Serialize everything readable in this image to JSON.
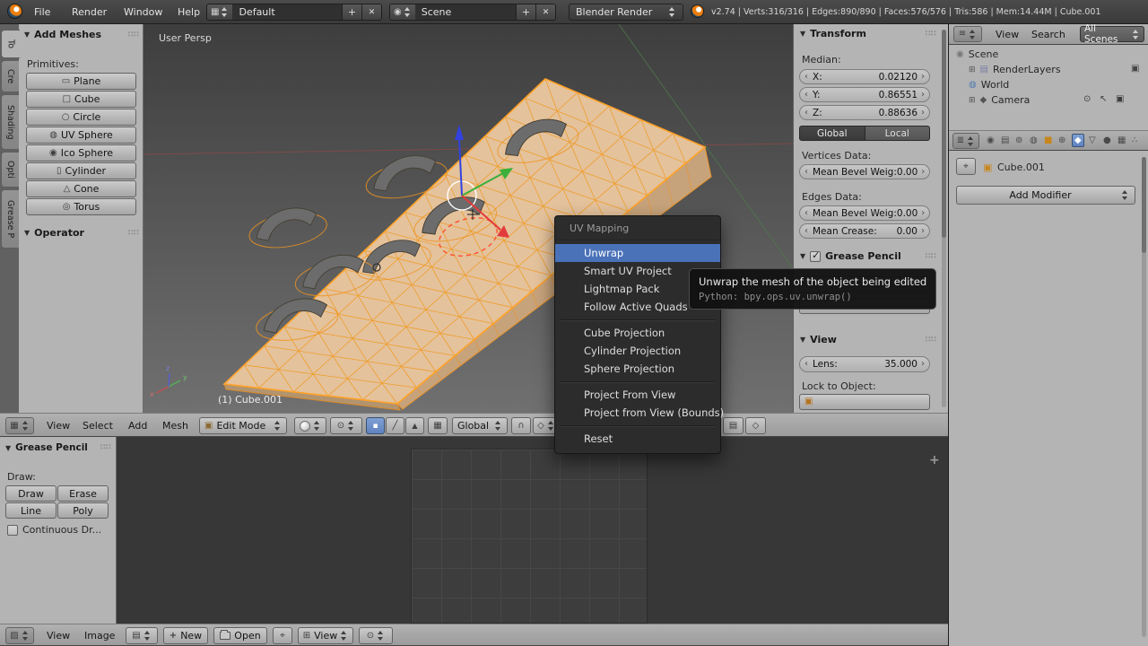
{
  "top": {
    "menus": [
      "File",
      "Render",
      "Window",
      "Help"
    ],
    "layout": "Default",
    "scene": "Scene",
    "engine": "Blender Render",
    "stats": "v2.74 | Verts:316/316 | Edges:890/890 | Faces:576/576 | Tris:586 | Mem:14.44M | Cube.001"
  },
  "shelf": {
    "tabs": [
      "To",
      "Cre",
      "Shading",
      "Opti",
      "Grease P"
    ],
    "add_meshes_title": "Add Meshes",
    "primitives_label": "Primitives:",
    "primitives": [
      "Plane",
      "Cube",
      "Circle",
      "UV Sphere",
      "Ico Sphere",
      "Cylinder",
      "Cone",
      "Torus"
    ],
    "operator_title": "Operator"
  },
  "viewport": {
    "view_label": "User Persp",
    "object_label": "(1) Cube.001",
    "axis": [
      "x",
      "y",
      "z"
    ]
  },
  "menu": {
    "title": "UV Mapping",
    "items": [
      "Unwrap",
      "Smart UV Project",
      "Lightmap Pack",
      "Follow Active Quads",
      "Cube Projection",
      "Cylinder Projection",
      "Sphere Projection",
      "Project From View",
      "Project from View (Bounds)",
      "Reset"
    ]
  },
  "tooltip": {
    "line1": "Unwrap the mesh of the object being edited",
    "line2": "Python: bpy.ops.uv.unwrap()"
  },
  "npanel": {
    "transform_title": "Transform",
    "median_label": "Median:",
    "x_label": "X:",
    "x_value": "0.02120",
    "y_label": "Y:",
    "y_value": "0.86551",
    "z_label": "Z:",
    "z_value": "0.88636",
    "global_btn": "Global",
    "local_btn": "Local",
    "vertices_label": "Vertices Data:",
    "vert_bevel_label": "Mean Bevel Weig:",
    "vert_bevel_value": "0.00",
    "edges_label": "Edges Data:",
    "edge_bevel_label": "Mean Bevel Weig:",
    "edge_bevel_value": "0.00",
    "crease_label": "Mean Crease:",
    "crease_value": "0.00",
    "grease_title": "Grease Pencil",
    "view_title": "View",
    "lens_label": "Lens:",
    "lens_value": "35.000",
    "lock_label": "Lock to Object:"
  },
  "outliner": {
    "menus": [
      "View",
      "Search"
    ],
    "all_scenes": "All Scenes",
    "rows": [
      "Scene",
      "RenderLayers",
      "World",
      "Camera"
    ]
  },
  "props": {
    "object_name": "Cube.001",
    "add_modifier": "Add Modifier"
  },
  "v3d": {
    "menus": [
      "View",
      "Select",
      "Add",
      "Mesh"
    ],
    "mode": "Edit Mode",
    "orientation": "Global"
  },
  "img_header": {
    "menus": [
      "View",
      "Image"
    ],
    "new_btn": "New",
    "open_btn": "Open",
    "view_btn": "View"
  },
  "img_shelf": {
    "grease_title": "Grease Pencil",
    "draw_label": "Draw:",
    "buttons": [
      "Draw",
      "Erase",
      "Line",
      "Poly"
    ],
    "continuous_label": "Continuous Dr..."
  },
  "icons": {
    "disclosure": "▼",
    "grip": "∷∷",
    "plus": "+",
    "close": "✕",
    "plane": "▭",
    "cube": "□",
    "circle": "○",
    "uv_sphere": "◍",
    "ico_sphere": "◉",
    "cylinder": "▯",
    "cone": "△",
    "torus": "◎",
    "scene": "◉",
    "render_layers": "▤",
    "world": "◍",
    "camera": "◆",
    "eye": "⊙",
    "pointer": "↖",
    "restrict_render": "▣",
    "expand": "⊞",
    "pin": "⌖",
    "magnet": "∩",
    "vertex": "▪",
    "edge": "╱",
    "face": "▲",
    "occlude": "▦",
    "editor_3d": "▦",
    "editor_image": "▨",
    "editor_outliner": "≡",
    "editor_props": "≣",
    "layout_icon": "▦",
    "scene_icon": "◉",
    "mode_cube": "▣",
    "mesh_cube": "▣",
    "image_icon": "▤",
    "snap_elem": "◇",
    "extra1": "▤",
    "extra2": "◇",
    "pivot": "⊙",
    "tabs": [
      "◉",
      "▤",
      "⊚",
      "◍",
      "■",
      "⊕",
      "◆",
      "▽",
      "●",
      "▦",
      "∴"
    ]
  }
}
